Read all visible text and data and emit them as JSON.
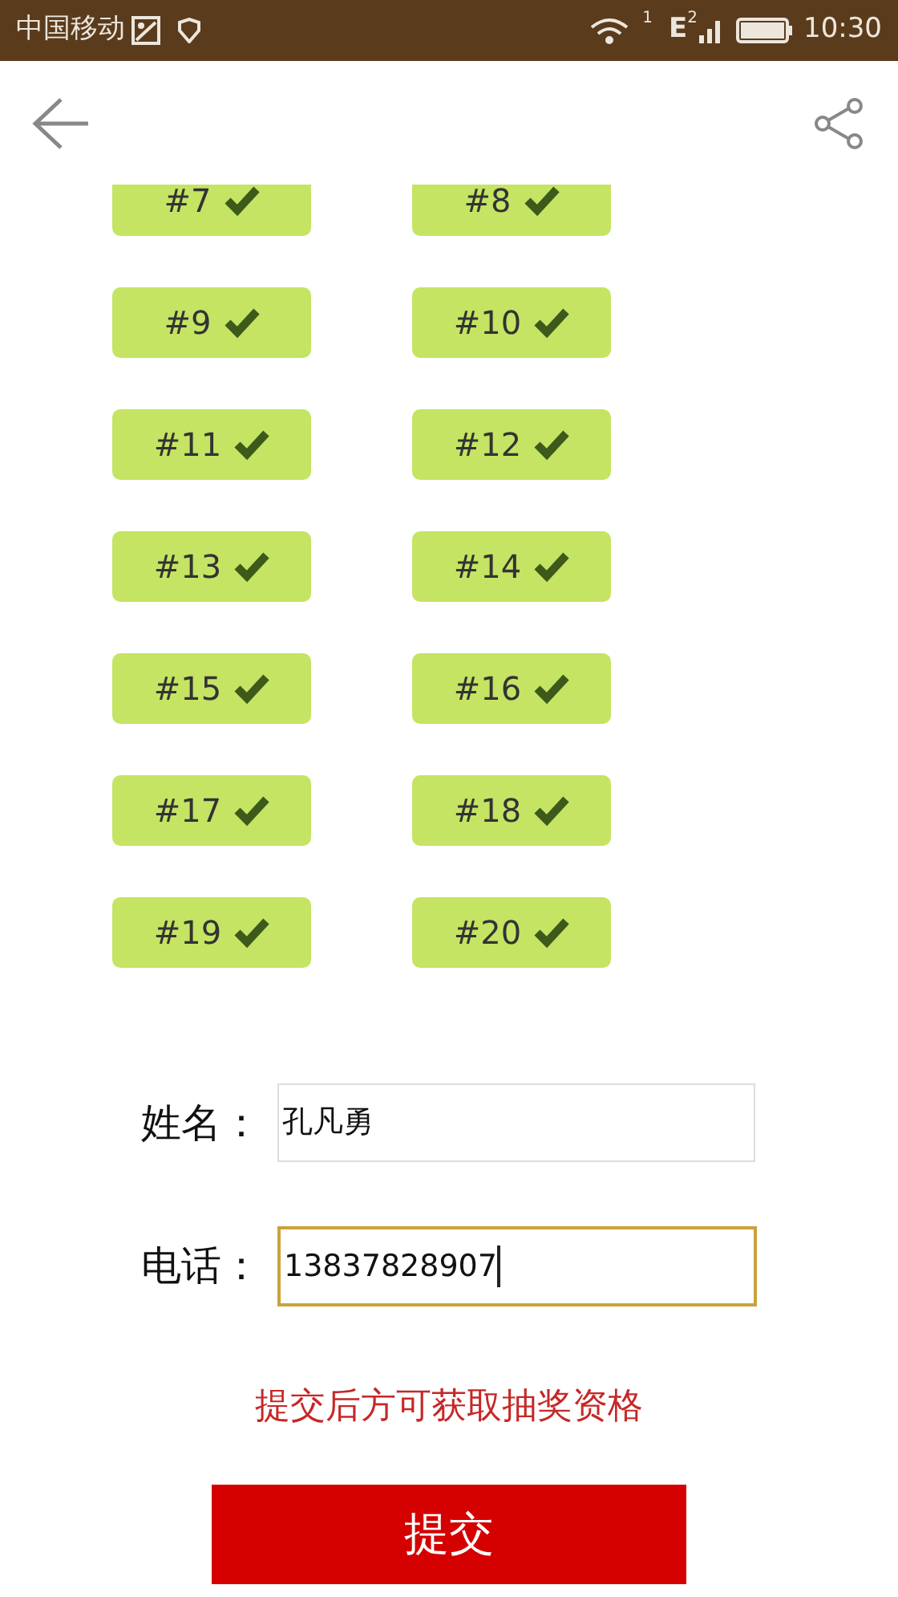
{
  "status_bar": {
    "carrier": "中国移动",
    "sim1": "1",
    "network": "E",
    "sim2": "2",
    "time": "10:30"
  },
  "tickets": [
    {
      "label": "#7",
      "checked": true
    },
    {
      "label": "#8",
      "checked": true
    },
    {
      "label": "#9",
      "checked": true
    },
    {
      "label": "#10",
      "checked": true
    },
    {
      "label": "#11",
      "checked": true
    },
    {
      "label": "#12",
      "checked": true
    },
    {
      "label": "#13",
      "checked": true
    },
    {
      "label": "#14",
      "checked": true
    },
    {
      "label": "#15",
      "checked": true
    },
    {
      "label": "#16",
      "checked": true
    },
    {
      "label": "#17",
      "checked": true
    },
    {
      "label": "#18",
      "checked": true
    },
    {
      "label": "#19",
      "checked": true
    },
    {
      "label": "#20",
      "checked": true
    }
  ],
  "form": [
    {
      "label": "姓名：",
      "value": "孔凡勇",
      "focused": false
    },
    {
      "label": "电话：",
      "value": "13837828907",
      "focused": true
    }
  ],
  "notice": "提交后方可获取抽奖资格",
  "submit": "提交"
}
